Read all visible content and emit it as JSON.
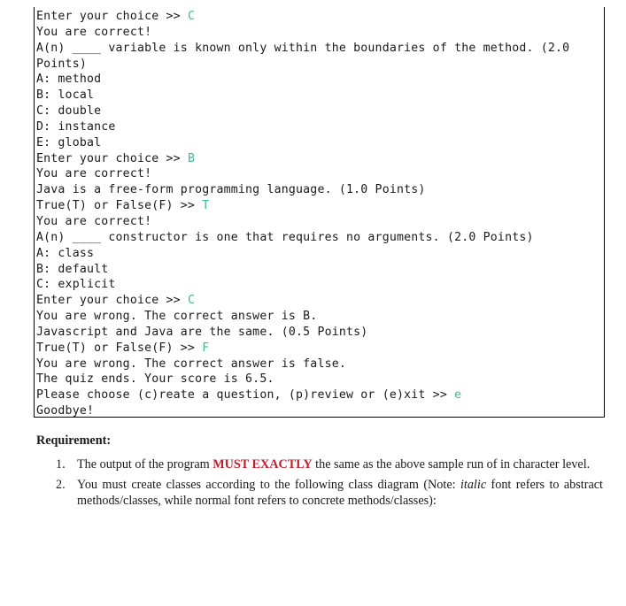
{
  "console": {
    "lines": [
      {
        "text": "Enter your choice >> ",
        "input": "C"
      },
      {
        "text": "You are correct!",
        "input": ""
      },
      {
        "text": "A(n) ____ variable is known only within the boundaries of the method. (2.0",
        "input": ""
      },
      {
        "text": "Points)",
        "input": ""
      },
      {
        "text": "A: method",
        "input": ""
      },
      {
        "text": "B: local",
        "input": ""
      },
      {
        "text": "C: double",
        "input": ""
      },
      {
        "text": "D: instance",
        "input": ""
      },
      {
        "text": "E: global",
        "input": ""
      },
      {
        "text": "Enter your choice >> ",
        "input": "B"
      },
      {
        "text": "You are correct!",
        "input": ""
      },
      {
        "text": "Java is a free-form programming language. (1.0 Points)",
        "input": ""
      },
      {
        "text": "True(T) or False(F) >> ",
        "input": "T"
      },
      {
        "text": "You are correct!",
        "input": ""
      },
      {
        "text": "A(n) ____ constructor is one that requires no arguments. (2.0 Points)",
        "input": ""
      },
      {
        "text": "A: class",
        "input": ""
      },
      {
        "text": "B: default",
        "input": ""
      },
      {
        "text": "C: explicit",
        "input": ""
      },
      {
        "text": "Enter your choice >> ",
        "input": "C"
      },
      {
        "text": "You are wrong. The correct answer is B.",
        "input": ""
      },
      {
        "text": "Javascript and Java are the same. (0.5 Points)",
        "input": ""
      },
      {
        "text": "True(T) or False(F) >> ",
        "input": "F"
      },
      {
        "text": "You are wrong. The correct answer is false.",
        "input": ""
      },
      {
        "text": "The quiz ends. Your score is 6.5.",
        "input": ""
      },
      {
        "text": "Please choose (c)reate a question, (p)review or (e)xit >> ",
        "input": "e"
      },
      {
        "text": "Goodbye!",
        "input": ""
      }
    ],
    "input_color": "#3cb89a"
  },
  "requirements": {
    "heading": "Requirement:",
    "items": [
      {
        "number": "1.",
        "before": "The output of the program ",
        "emphasis": "MUST EXACTLY",
        "after": " the same as the above sample run of in character level."
      },
      {
        "number": "2.",
        "before": "You must create classes according to the following class diagram (Note: ",
        "italic": "italic",
        "after": " font refers to abstract methods/classes, while normal font refers to concrete methods/classes):"
      }
    ],
    "emphasis_color": "#c0202c"
  }
}
